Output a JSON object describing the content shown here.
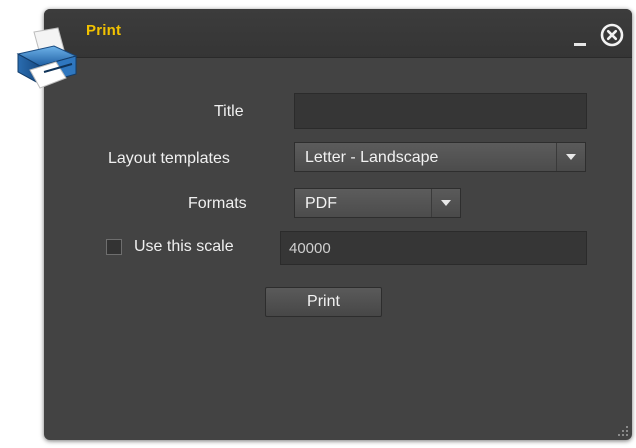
{
  "window": {
    "title": "Print",
    "title_color": "#f2c200",
    "minimize_icon": "minimize-icon",
    "close_icon": "close-circle-icon",
    "app_icon": "printer-icon"
  },
  "form": {
    "title_label": "Title",
    "title_value": "",
    "layout_label": "Layout templates",
    "layout_value": "Letter - Landscape",
    "formats_label": "Formats",
    "formats_value": "PDF",
    "scale_label": "Use this scale",
    "scale_checked": false,
    "scale_value": "40000",
    "print_button": "Print"
  },
  "colors": {
    "panel_background": "#434343",
    "field_background": "#363636",
    "text": "#f0f0f0"
  }
}
